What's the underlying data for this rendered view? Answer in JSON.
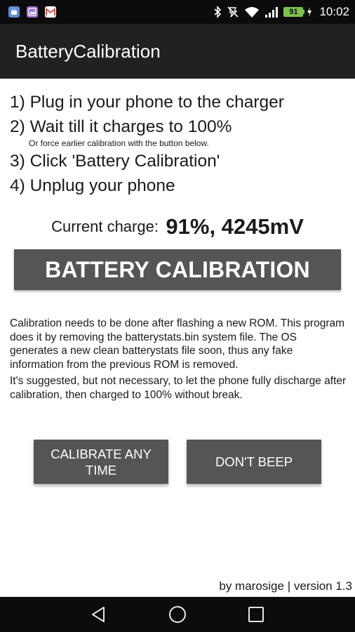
{
  "status_bar": {
    "notification_icons": [
      {
        "name": "android-app-icon",
        "color": "#5b8fd6"
      },
      {
        "name": "gallery-app-icon",
        "color": "#9a6fd0"
      },
      {
        "name": "gmail-icon",
        "color": "#d9534f"
      }
    ],
    "battery_level": "91",
    "time": "10:02",
    "icons": [
      "bluetooth-icon",
      "vibrate-off-icon",
      "wifi-icon",
      "signal-icon",
      "battery-icon",
      "charging-icon"
    ]
  },
  "app_bar": {
    "title": "BatteryCalibration",
    "background": "#212121"
  },
  "steps": [
    "1) Plug in your phone to the charger",
    "2) Wait till it charges to 100%",
    "3) Click 'Battery Calibration'",
    "4) Unplug your phone"
  ],
  "step_note": "Or force earlier calibration with the button below.",
  "charge": {
    "label": "Current charge:",
    "value": "91%, 4245mV"
  },
  "main_button": {
    "label": "BATTERY CALIBRATION",
    "color": "#555555"
  },
  "info": {
    "paragraph_1": "Calibration needs to be done after flashing a new ROM. This program does it by removing the batterystats.bin system file. The OS generates a new clean batterystats file soon, thus any fake information from the previous ROM is removed.",
    "paragraph_2": "It's suggested, but not necessary, to let the phone fully discharge after calibration, then charged to 100% without break."
  },
  "buttons": {
    "calibrate_any_time": "CALIBRATE ANY TIME",
    "dont_beep": "DON'T BEEP"
  },
  "footer": "by marosige | version 1.3",
  "nav_bar": {
    "items": [
      "back-icon",
      "home-icon",
      "recents-icon"
    ]
  }
}
